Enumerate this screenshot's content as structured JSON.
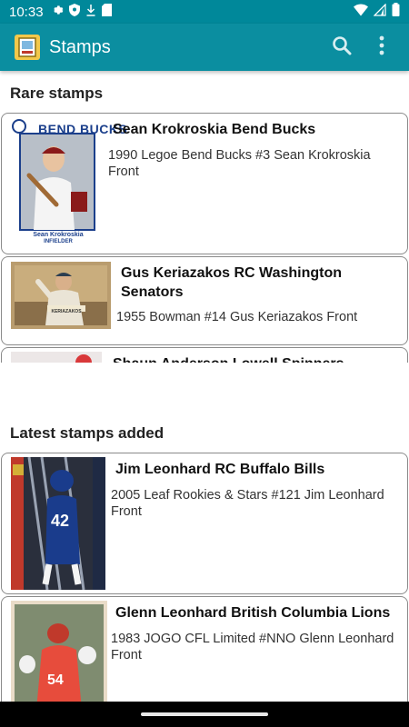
{
  "status_bar": {
    "time": "10:33",
    "left_icons": [
      "gear-icon",
      "shield-icon",
      "download-icon",
      "sd-card-icon"
    ],
    "right_icons": [
      "wifi-icon",
      "cell-signal-icon",
      "battery-icon"
    ]
  },
  "app_bar": {
    "title": "Stamps",
    "search_icon": "search-icon",
    "overflow_icon": "more-vert-icon"
  },
  "colors": {
    "primary": "#0b8ea0",
    "status_bar": "#00889a"
  },
  "rare_section": {
    "title": "Rare stamps",
    "items": [
      {
        "title": "Sean Krokroskia Bend Bucks",
        "description": "1990 Legoe Bend Bucks #3 Sean Krokroskia Front",
        "card_text_top": "BEND BUCKS",
        "card_text_bottom_name": "Sean Krokroskia",
        "card_text_bottom_pos": "INFIELDER"
      },
      {
        "title": "Gus Keriazakos RC Washington Senators",
        "description": "1955 Bowman #14 Gus Keriazakos Front",
        "card_text_name": "KERIAZAKOS"
      },
      {
        "title": "Shaun Anderson Lowell Spinners",
        "description": ""
      }
    ]
  },
  "latest_section": {
    "title": "Latest stamps added",
    "items": [
      {
        "title": "Jim Leonhard RC Buffalo Bills",
        "description": "2005 Leaf Rookies & Stars #121 Jim Leonhard Front",
        "card_number": "42"
      },
      {
        "title": "Glenn Leonhard British Columbia Lions",
        "description": "1983 JOGO CFL Limited #NNO Glenn Leonhard Front",
        "card_number": "54"
      }
    ]
  }
}
